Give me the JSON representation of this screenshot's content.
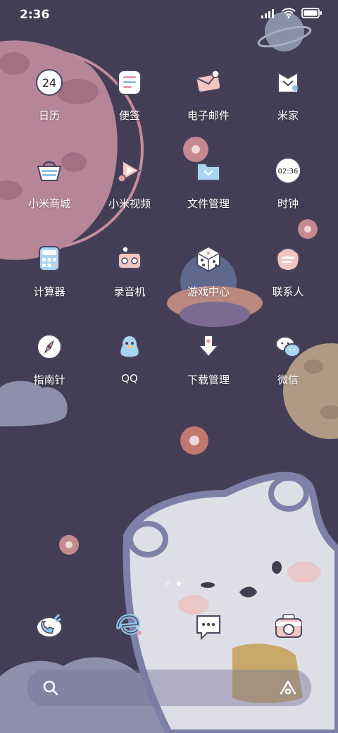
{
  "status_bar": {
    "time": "2:36",
    "icons": [
      "signal-icon",
      "wifi-icon",
      "battery-icon"
    ]
  },
  "apps": [
    {
      "label": "日历",
      "icon": "calendar-icon",
      "badge_text": "24"
    },
    {
      "label": "便签",
      "icon": "notes-icon"
    },
    {
      "label": "电子邮件",
      "icon": "email-icon"
    },
    {
      "label": "米家",
      "icon": "mijia-icon"
    },
    {
      "label": "小米商城",
      "icon": "shopping-bag-icon"
    },
    {
      "label": "小米视频",
      "icon": "video-play-icon"
    },
    {
      "label": "文件管理",
      "icon": "folder-icon"
    },
    {
      "label": "时钟",
      "icon": "clock-icon",
      "badge_text": "02:36"
    },
    {
      "label": "计算器",
      "icon": "calculator-icon"
    },
    {
      "label": "录音机",
      "icon": "recorder-icon"
    },
    {
      "label": "游戏中心",
      "icon": "dice-icon"
    },
    {
      "label": "联系人",
      "icon": "contacts-icon"
    },
    {
      "label": "指南针",
      "icon": "compass-icon"
    },
    {
      "label": "QQ",
      "icon": "qq-penguin-icon"
    },
    {
      "label": "下载管理",
      "icon": "download-icon"
    },
    {
      "label": "微信",
      "icon": "wechat-icon"
    }
  ],
  "page_indicator": {
    "pages": 3,
    "active": 3
  },
  "dock": [
    {
      "icon": "phone-icon"
    },
    {
      "icon": "browser-icon"
    },
    {
      "icon": "messages-icon"
    },
    {
      "icon": "camera-icon"
    }
  ],
  "search_bar": {
    "left_icon": "search-icon",
    "right_icon": "assistant-icon"
  },
  "colors": {
    "background": "#433e55",
    "icon_fill": "#ffffff",
    "icon_outline": "#4a4660",
    "accent_pink": "#e8a0a8",
    "accent_blue": "#8fc3e6"
  }
}
